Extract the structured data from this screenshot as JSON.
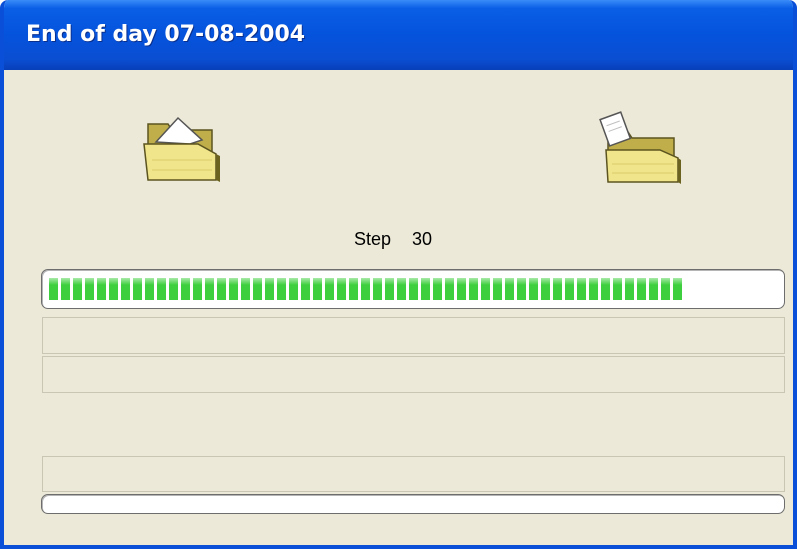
{
  "window": {
    "title": "End of day 07-08-2004"
  },
  "icons": {
    "source_folder": "open-folder-icon",
    "destination_folder": "folder-with-document-icon"
  },
  "status": {
    "step_label": "Step",
    "step_number": "30"
  },
  "progress": {
    "main_fraction": 0.89,
    "secondary_fraction": 0.0,
    "fill_color": "#3dcf3d"
  },
  "panels": {
    "info_line_1": "",
    "info_line_2": "",
    "info_line_3": ""
  },
  "colors": {
    "titlebar": "#0553dc",
    "window_border": "#0a4fd8",
    "dialog_background": "#ece9d8"
  }
}
